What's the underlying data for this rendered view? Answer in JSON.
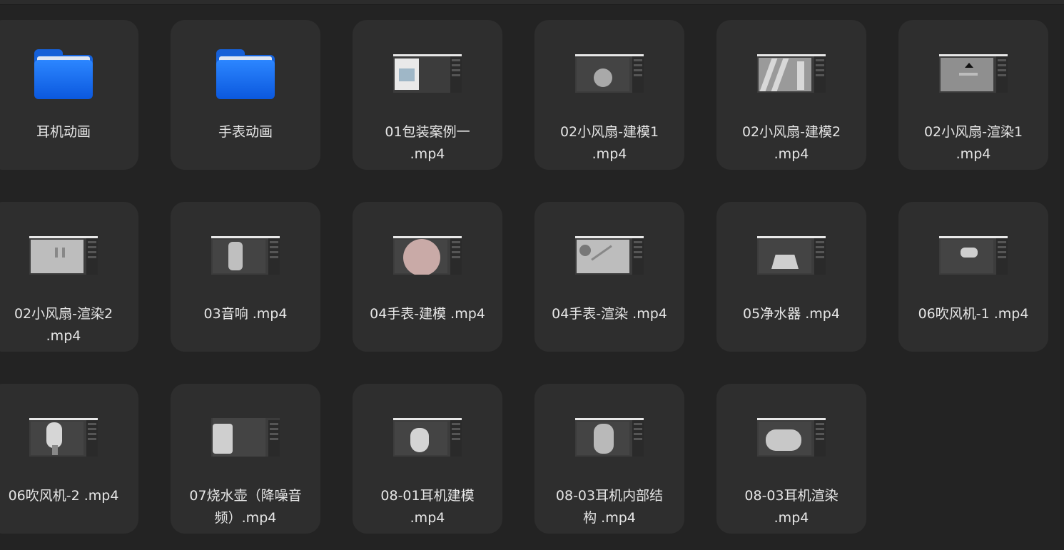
{
  "items": [
    {
      "name": "耳机动画",
      "kind": "folder",
      "icon": "folder-icon"
    },
    {
      "name": "手表动画",
      "kind": "folder",
      "icon": "folder-icon"
    },
    {
      "name": "01包装案例一\n.mp4",
      "kind": "video",
      "thumb": "packaging"
    },
    {
      "name": "02小风扇-建模1\n.mp4",
      "kind": "video",
      "thumb": "fan-model-1"
    },
    {
      "name": "02小风扇-建模2\n.mp4",
      "kind": "video",
      "thumb": "fan-model-2"
    },
    {
      "name": "02小风扇-渲染1\n.mp4",
      "kind": "video",
      "thumb": "fan-render-1"
    },
    {
      "name": "02小风扇-渲染2\n.mp4",
      "kind": "video",
      "thumb": "fan-render-2"
    },
    {
      "name": "03音响 .mp4",
      "kind": "video",
      "thumb": "speaker"
    },
    {
      "name": "04手表-建模 .mp4",
      "kind": "video",
      "thumb": "watch-model"
    },
    {
      "name": "04手表-渲染 .mp4",
      "kind": "video",
      "thumb": "watch-render"
    },
    {
      "name": "05净水器 .mp4",
      "kind": "video",
      "thumb": "purifier"
    },
    {
      "name": "06吹风机-1 .mp4",
      "kind": "video",
      "thumb": "dryer-1"
    },
    {
      "name": "06吹风机-2 .mp4",
      "kind": "video",
      "thumb": "dryer-2"
    },
    {
      "name": "07烧水壶（降噪音\n频）.mp4",
      "kind": "video",
      "thumb": "kettle"
    },
    {
      "name": "08-01耳机建模\n.mp4",
      "kind": "video",
      "thumb": "earbuds-model"
    },
    {
      "name": "08-03耳机内部结\n构 .mp4",
      "kind": "video",
      "thumb": "earbuds-structure"
    },
    {
      "name": "08-03耳机渲染\n.mp4",
      "kind": "video",
      "thumb": "earbuds-render"
    }
  ],
  "colors": {
    "background": "#232323",
    "tile": "#2e2e2e",
    "text": "#e6e6e6",
    "folder": "#1663dc"
  }
}
